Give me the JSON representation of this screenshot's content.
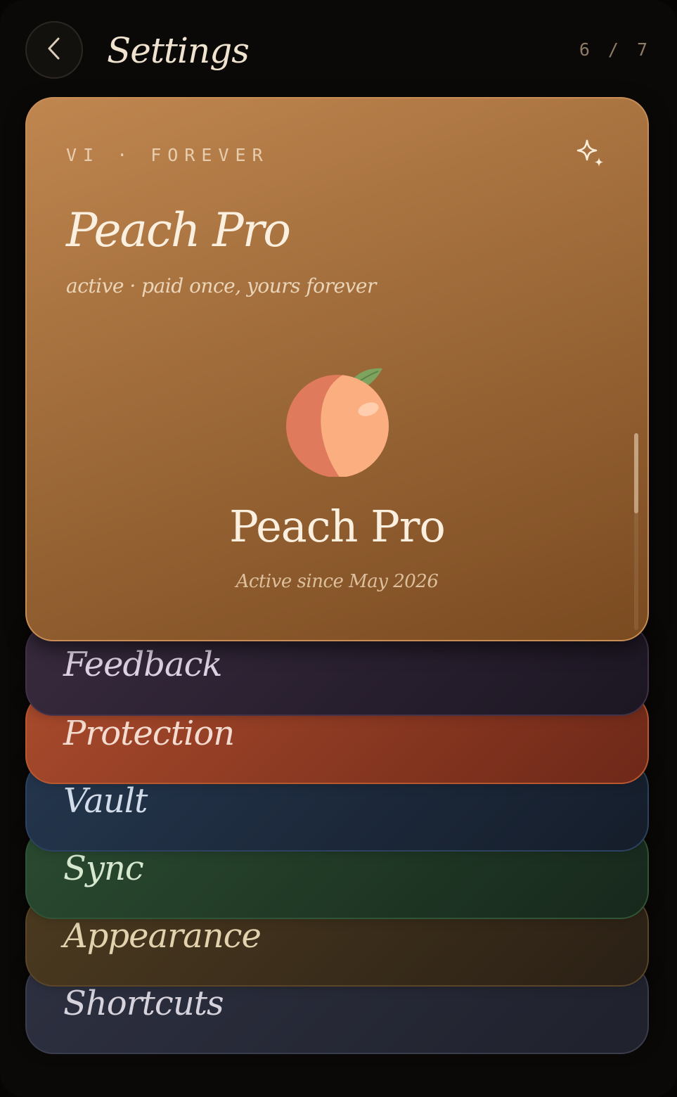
{
  "header": {
    "title": "Settings",
    "pager_current": "6",
    "pager_separator": "/",
    "pager_total": "7"
  },
  "pro_card": {
    "tag": "VI · FOREVER",
    "title": "Peach Pro",
    "subtitle": "active · paid once, yours forever",
    "name": "Peach Pro",
    "since": "Active since May 2026"
  },
  "cards": {
    "feedback": "Feedback",
    "protection": "Protection",
    "vault": "Vault",
    "sync": "Sync",
    "appearance": "Appearance",
    "shortcuts": "Shortcuts"
  },
  "icons": {
    "back": "chevron-left-icon",
    "sparkle": "sparkle-icon",
    "peach": "peach-icon"
  },
  "colors": {
    "background": "#0b0907",
    "pro_card": "#a6713e",
    "feedback": "#2c2131",
    "protection": "#8c3a22",
    "vault": "#1d2a3b",
    "sync": "#213a26",
    "appearance": "#3a2d1a",
    "shortcuts": "#262835"
  }
}
